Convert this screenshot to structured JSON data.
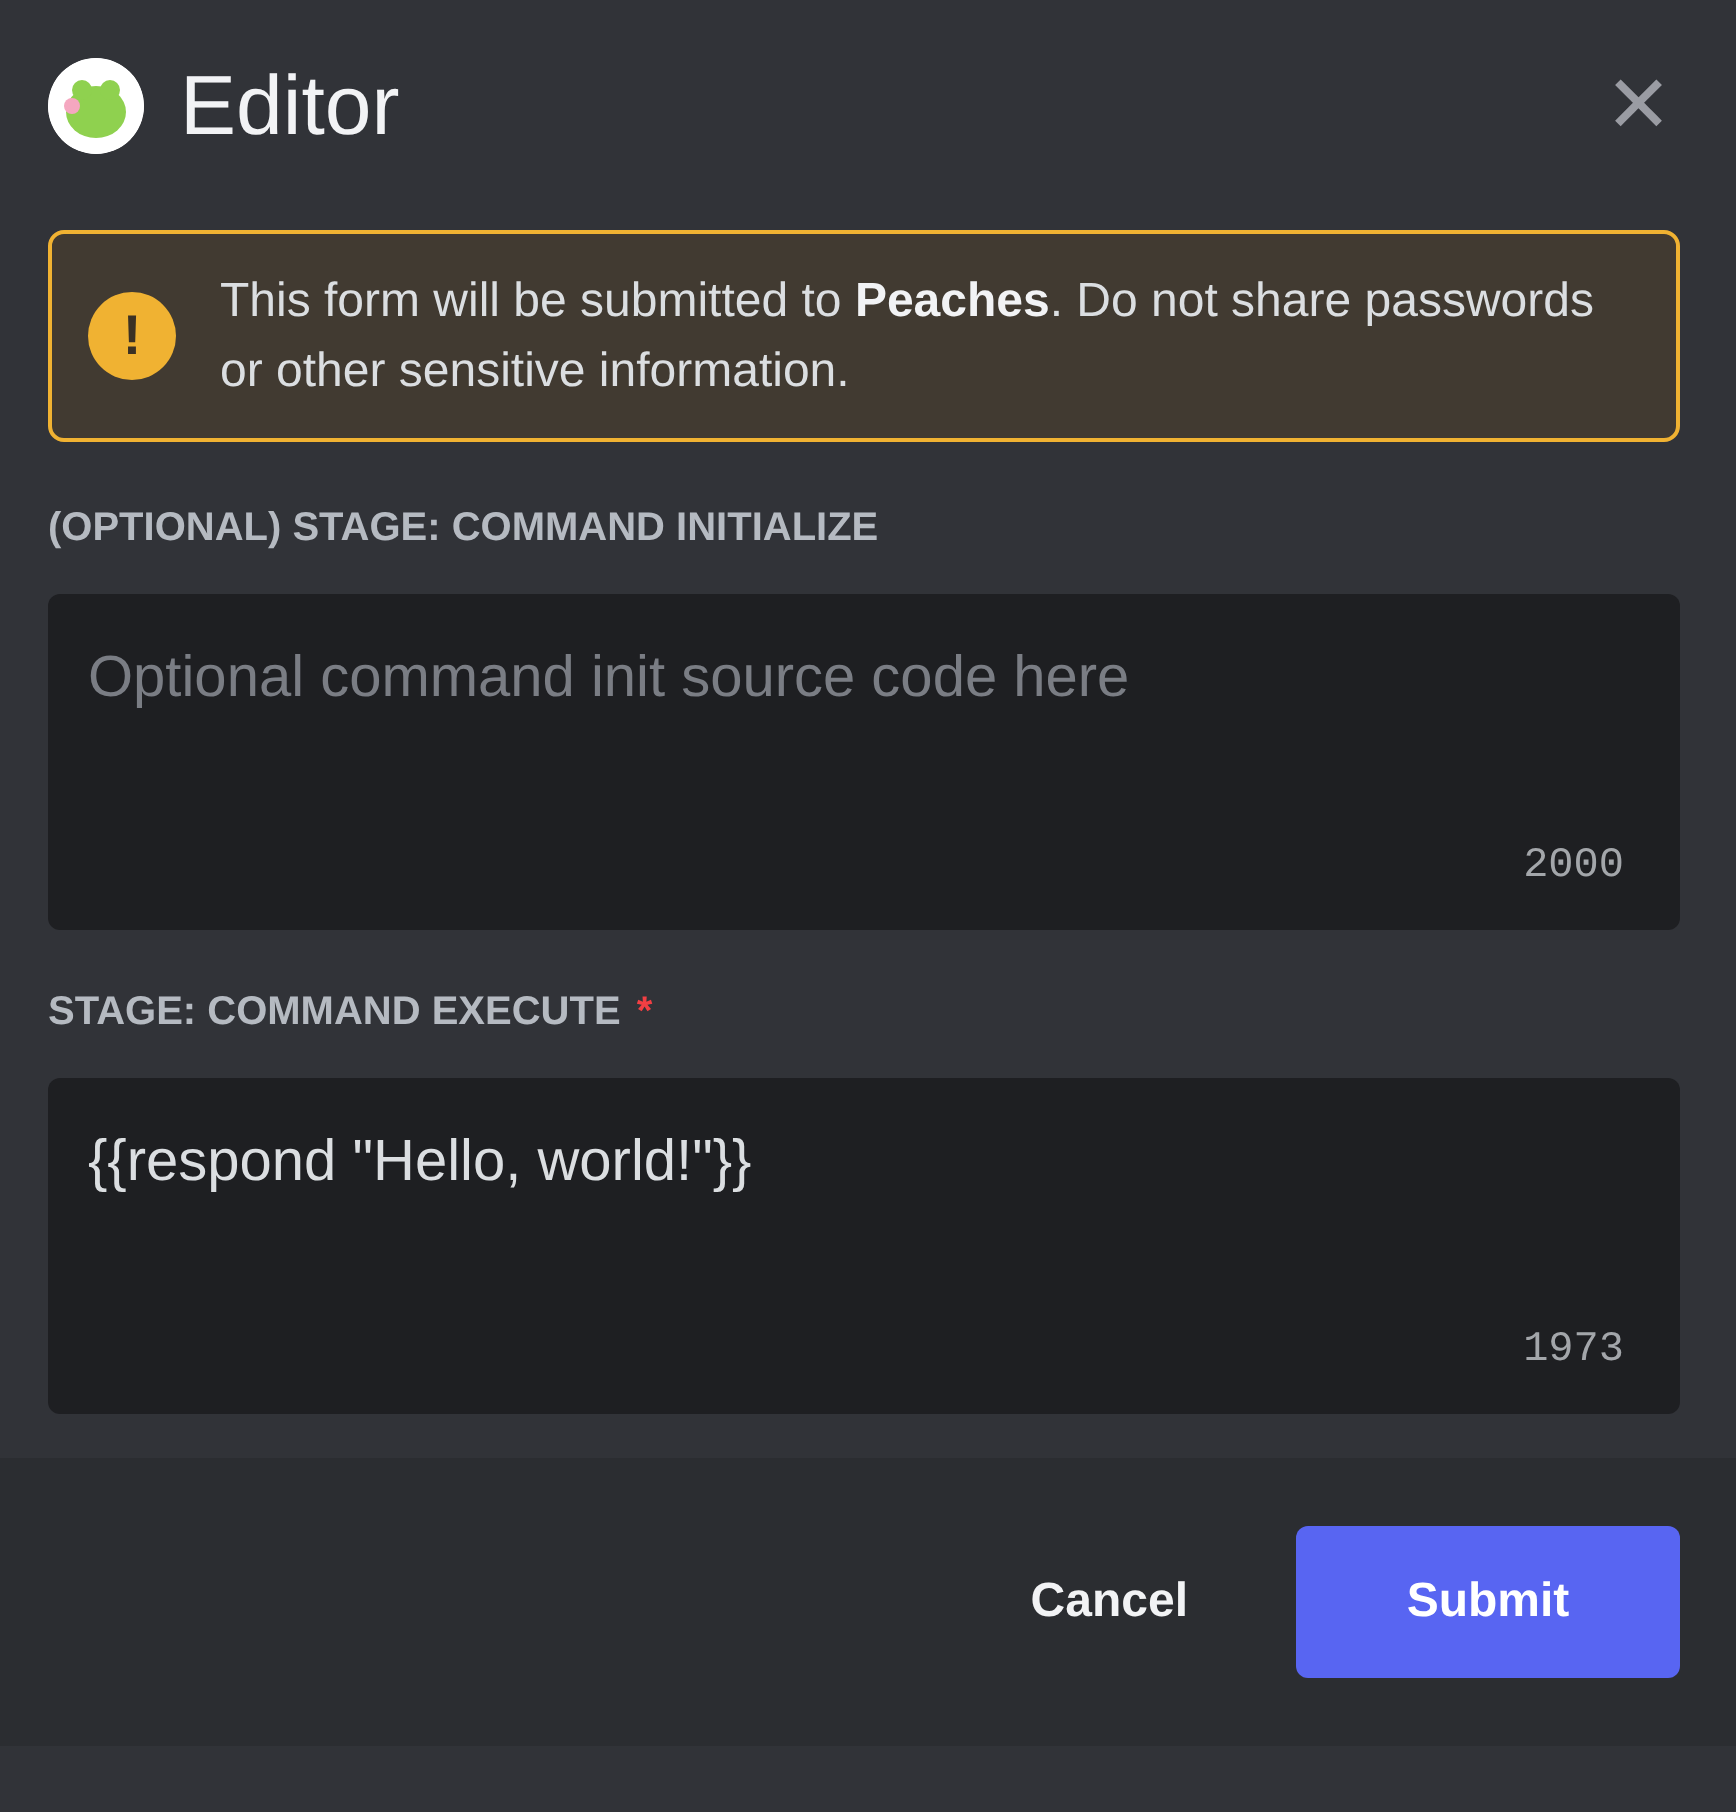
{
  "window": {
    "title": "Editor",
    "close": "✕"
  },
  "warning": {
    "icon": "!",
    "text": "This form will be submitted to **Peaches**. Do not share passwords or other sensitive information."
  },
  "fields": [
    {
      "label": "(OPTIONAL) STAGE: COMMAND INITIALIZE",
      "placeholder": "Optional command init source code here",
      "counter": "2000"
    },
    {
      "label": "STAGE: COMMAND EXECUTE",
      "required_mark": "*",
      "value": "{{respond \"Hello, world!\"}}",
      "counter": "1973"
    }
  ],
  "buttons": [
    {
      "label": "Cancel",
      "kind": "link"
    },
    {
      "label": "Submit",
      "kind": "primary"
    }
  ]
}
